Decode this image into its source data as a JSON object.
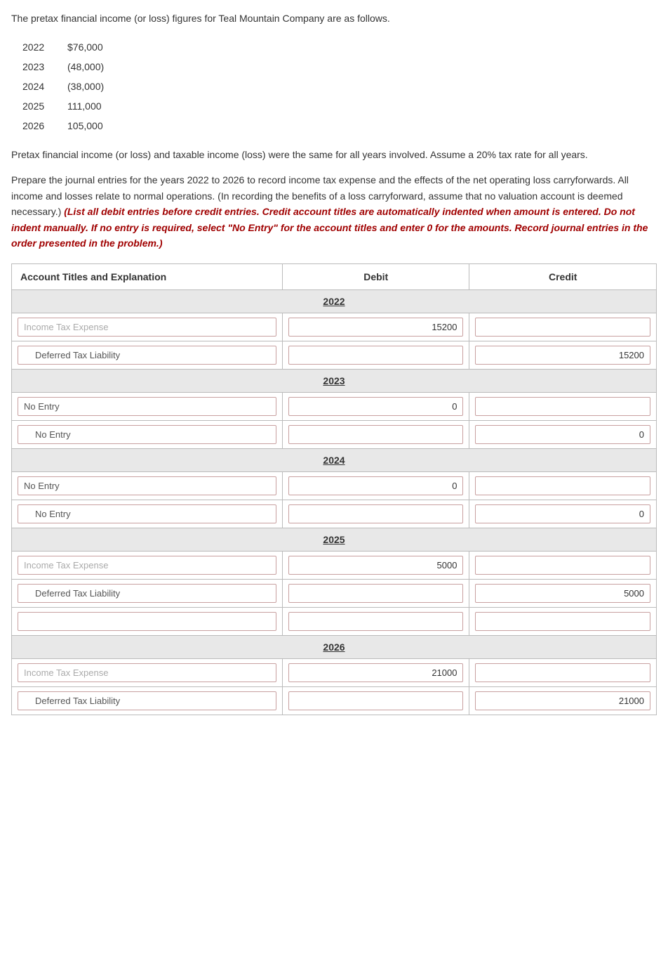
{
  "intro": {
    "line1": "The pretax financial income (or loss) figures for Teal Mountain Company are as follows."
  },
  "years_data": [
    {
      "year": "2022",
      "amount": "$76,000"
    },
    {
      "year": "2023",
      "amount": "(48,000)"
    },
    {
      "year": "2024",
      "amount": "(38,000)"
    },
    {
      "year": "2025",
      "amount": "111,000"
    },
    {
      "year": "2026",
      "amount": "105,000"
    }
  ],
  "middle_text": "Pretax financial income (or loss) and taxable income (loss) were the same for all years involved. Assume a 20% tax rate for all years.",
  "instructions": "Prepare the journal entries for the years 2022 to 2026 to record income tax expense and the effects of the net operating loss carryforwards. All income and losses relate to normal operations. (In recording the benefits of a loss carryforward, assume that no valuation account is deemed necessary.)",
  "instructions_italic": "(List all debit entries before credit entries. Credit account titles are automatically indented when amount is entered. Do not indent manually. If no entry is required, select \"No Entry\" for the account titles and enter 0 for the amounts. Record journal entries in the order presented in the problem.)",
  "table": {
    "headers": {
      "account": "Account Titles and Explanation",
      "debit": "Debit",
      "credit": "Credit"
    },
    "sections": [
      {
        "year": "2022",
        "rows": [
          {
            "account": "Income Tax Expense",
            "debit": "15200",
            "credit": "",
            "account_style": "greyed",
            "debit_has_value": true,
            "credit_has_value": false
          },
          {
            "account": "Deferred Tax Liability",
            "debit": "",
            "credit": "15200",
            "account_style": "indented",
            "debit_has_value": false,
            "credit_has_value": true
          }
        ]
      },
      {
        "year": "2023",
        "rows": [
          {
            "account": "No Entry",
            "debit": "0",
            "credit": "",
            "account_style": "normal",
            "debit_has_value": true,
            "credit_has_value": false
          },
          {
            "account": "No Entry",
            "debit": "",
            "credit": "0",
            "account_style": "indented",
            "debit_has_value": false,
            "credit_has_value": true
          }
        ]
      },
      {
        "year": "2024",
        "rows": [
          {
            "account": "No Entry",
            "debit": "0",
            "credit": "",
            "account_style": "normal",
            "debit_has_value": true,
            "credit_has_value": false
          },
          {
            "account": "No Entry",
            "debit": "",
            "credit": "0",
            "account_style": "indented",
            "debit_has_value": false,
            "credit_has_value": true
          }
        ]
      },
      {
        "year": "2025",
        "rows": [
          {
            "account": "Income Tax Expense",
            "debit": "5000",
            "credit": "",
            "account_style": "greyed",
            "debit_has_value": true,
            "credit_has_value": false
          },
          {
            "account": "Deferred Tax Liability",
            "debit": "",
            "credit": "5000",
            "account_style": "indented",
            "debit_has_value": false,
            "credit_has_value": true
          },
          {
            "account": "",
            "debit": "",
            "credit": "",
            "account_style": "empty",
            "debit_has_value": false,
            "credit_has_value": false
          }
        ]
      },
      {
        "year": "2026",
        "rows": [
          {
            "account": "Income Tax Expense",
            "debit": "21000",
            "credit": "",
            "account_style": "greyed",
            "debit_has_value": true,
            "credit_has_value": false
          },
          {
            "account": "Deferred Tax Liability",
            "debit": "",
            "credit": "21000",
            "account_style": "indented",
            "debit_has_value": false,
            "credit_has_value": true
          }
        ]
      }
    ]
  }
}
